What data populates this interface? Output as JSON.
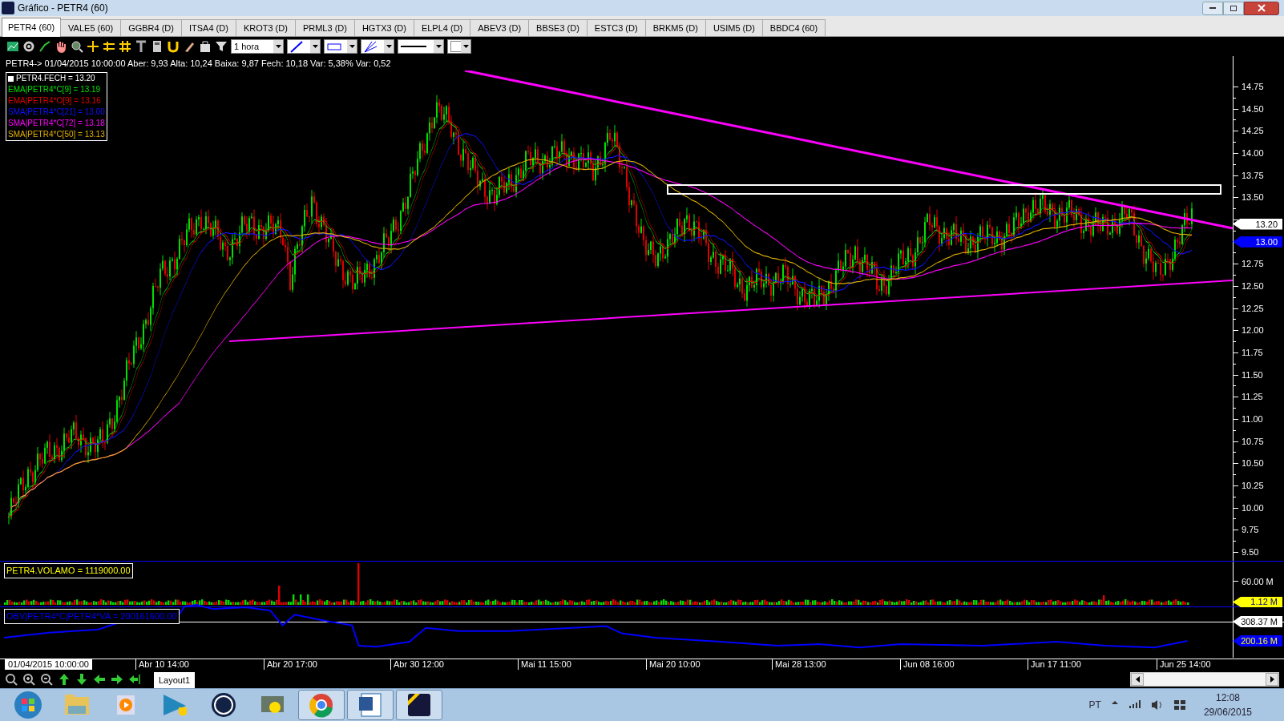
{
  "window": {
    "title": "Gráfico - PETR4 (60)"
  },
  "tabs": [
    {
      "label": "PETR4 (60)",
      "selected": true
    },
    {
      "label": "VALE5 (60)",
      "selected": false
    },
    {
      "label": "GGBR4 (D)",
      "selected": false
    },
    {
      "label": "ITSA4 (D)",
      "selected": false
    },
    {
      "label": "KROT3 (D)",
      "selected": false
    },
    {
      "label": "PRML3 (D)",
      "selected": false
    },
    {
      "label": "HGTX3 (D)",
      "selected": false
    },
    {
      "label": "ELPL4 (D)",
      "selected": false
    },
    {
      "label": "ABEV3 (D)",
      "selected": false
    },
    {
      "label": "BBSE3 (D)",
      "selected": false
    },
    {
      "label": "ESTC3 (D)",
      "selected": false
    },
    {
      "label": "BRKM5 (D)",
      "selected": false
    },
    {
      "label": "USIM5 (D)",
      "selected": false
    },
    {
      "label": "BBDC4 (60)",
      "selected": false
    }
  ],
  "toolbar": {
    "period": "1 hora"
  },
  "info_line": "PETR4-> 01/04/2015 10:00:00 Aber: 9,93 Alta: 10,24 Baixa: 9,87 Fech: 10,18 Var: 5,38% Var: 0,52",
  "price_panel": {
    "legend": [
      {
        "text": "PETR4.FECH = 13.20",
        "color": "#ffffff"
      },
      {
        "text": "EMA|PETR4*C[9] = 13.19",
        "color": "#00e000"
      },
      {
        "text": "EMA|PETR4*O[9] = 13.16",
        "color": "#e00000"
      },
      {
        "text": "SMA|PETR4*C[21] = 13.00",
        "color": "#1010ff"
      },
      {
        "text": "SMA|PETR4*C[72] = 13.18",
        "color": "#ff00ff"
      },
      {
        "text": "SMA|PETR4*C[50] = 13.13",
        "color": "#e0b000"
      }
    ],
    "axis_labels": [
      "14.75",
      "14.50",
      "14.25",
      "14.00",
      "13.75",
      "13.50",
      "12.75",
      "12.50",
      "12.25",
      "12.00",
      "11.75",
      "11.50",
      "11.25",
      "11.00",
      "10.75",
      "10.50",
      "10.25",
      "10.00",
      "9.75",
      "9.50"
    ],
    "tags": [
      {
        "text": "13.20",
        "color": "#ffffff"
      },
      {
        "text": "13.00",
        "color": "#0000ff"
      }
    ]
  },
  "volume_panel": {
    "legend": "PETR4.VOLAMO = 1119000.00",
    "axis_label": "60.00 M",
    "tag": "1.12 M"
  },
  "obv_panel": {
    "legend": "OBV|PETR4*C|PETR4*VA = 200161600.00",
    "tags": [
      {
        "text": "308.37 M",
        "color": "#ffffff"
      },
      {
        "text": "200.16 M",
        "color": "#0000ff"
      }
    ]
  },
  "date_axis": [
    "01/04/2015 10:00:00",
    "Abr 10 14:00",
    "Abr 20 17:00",
    "Abr 30 12:00",
    "Mai 11 15:00",
    "Mai 20 10:00",
    "Mai 28 13:00",
    "Jun 08 16:00",
    "Jun 17 11:00",
    "Jun 25 14:00"
  ],
  "layout_tab": "Layout1",
  "taskbar": {
    "language": "PT",
    "time": "12:08",
    "date": "29/06/2015"
  }
}
